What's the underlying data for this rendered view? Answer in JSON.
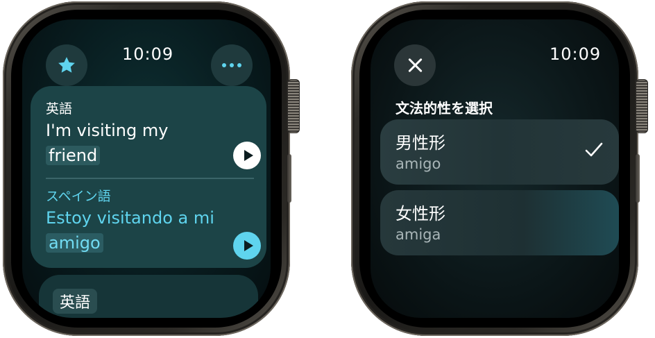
{
  "left_watch": {
    "time": "10:09",
    "star_icon": "star-icon",
    "more_icon": "ellipsis-icon",
    "source": {
      "language": "英語",
      "text_before": "I'm visiting my ",
      "text_highlight": "friend"
    },
    "target": {
      "language": "スペイン語",
      "text_before": "Estoy visitando a mi ",
      "text_highlight": "amigo"
    },
    "next_card_chip": "英語"
  },
  "right_watch": {
    "time": "10:09",
    "close_icon": "close-icon",
    "section_title": "文法的性を選択",
    "options": [
      {
        "label": "男性形",
        "word": "amigo",
        "selected": true
      },
      {
        "label": "女性形",
        "word": "amiga",
        "selected": false
      }
    ]
  },
  "colors": {
    "accent": "#5fd4ee",
    "card_bg": "#1c4447"
  }
}
